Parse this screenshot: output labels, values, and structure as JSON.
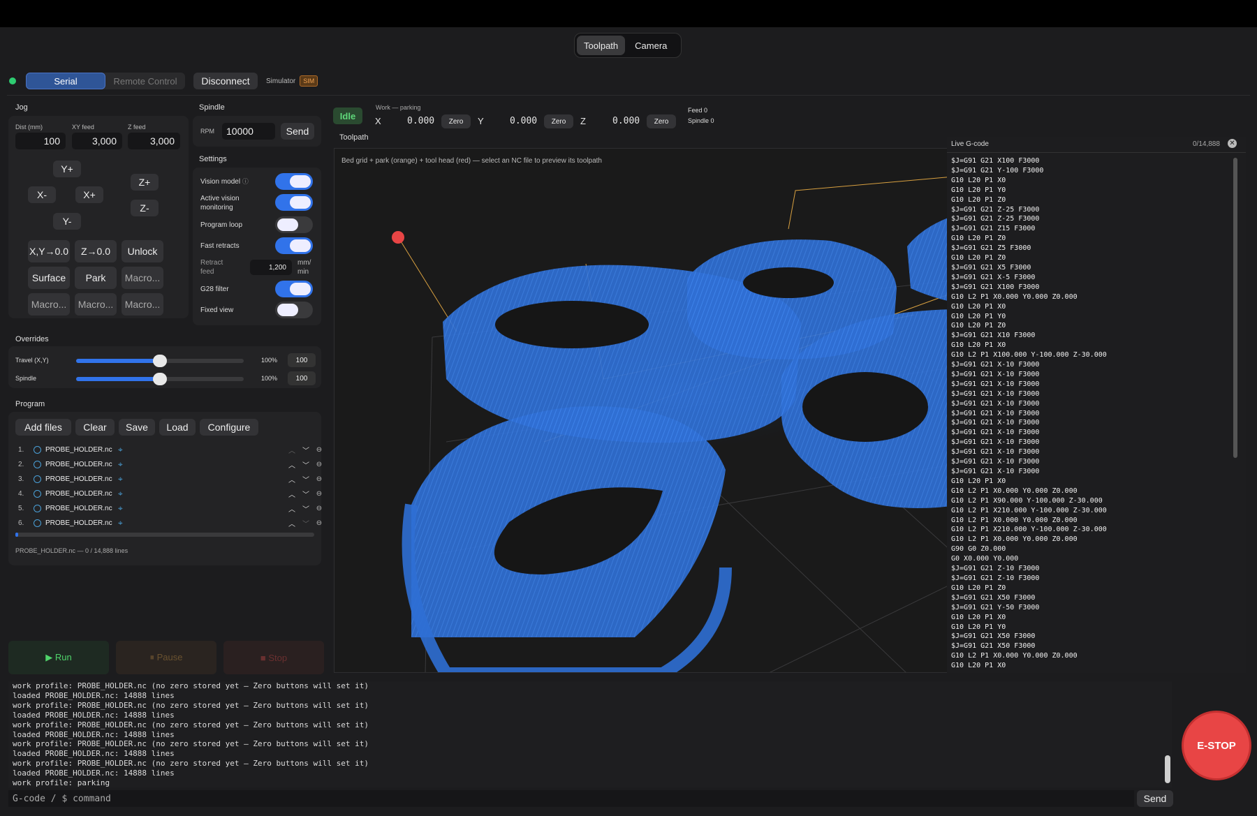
{
  "view_tabs": [
    "Toolpath",
    "Camera"
  ],
  "connection": {
    "modes": [
      "Serial",
      "Remote Control"
    ],
    "disconnect_label": "Disconnect",
    "simulator_label": "Simulator",
    "sim_badge": "SIM",
    "status_color": "#2ecc71"
  },
  "jog": {
    "title": "Jog",
    "dist_label": "Dist (mm)",
    "dist_value": "100",
    "xy_feed_label": "XY feed",
    "xy_feed_value": "3,000",
    "z_feed_label": "Z feed",
    "z_feed_value": "3,000",
    "y_plus": "Y+",
    "x_minus": "X-",
    "x_plus": "X+",
    "y_minus": "Y-",
    "z_plus": "Z+",
    "z_minus": "Z-",
    "buttons": [
      "X,Y→0.0",
      "Z→0.0",
      "Unlock",
      "Surface",
      "Park",
      "Macro...",
      "Macro...",
      "Macro...",
      "Macro..."
    ]
  },
  "spindle": {
    "title": "Spindle",
    "rpm_label": "RPM",
    "rpm_value": "10000",
    "send_label": "Send"
  },
  "settings": {
    "title": "Settings",
    "items": [
      {
        "label": "Vision model",
        "on": true,
        "info": true
      },
      {
        "label": "Active vision monitoring",
        "on": true
      },
      {
        "label": "Program loop",
        "on": false
      },
      {
        "label": "Fast retracts",
        "on": true
      },
      {
        "label": "G28 filter",
        "on": true
      },
      {
        "label": "Fixed view",
        "on": false
      }
    ],
    "retract_feed_label": "Retract feed",
    "retract_feed_value": "1,200",
    "retract_feed_unit": "mm/ min"
  },
  "overrides": {
    "title": "Overrides",
    "rows": [
      {
        "label": "Travel (X,Y)",
        "percent_text": "100%",
        "value": "100",
        "fraction": 0.5
      },
      {
        "label": "Spindle",
        "percent_text": "100%",
        "value": "100",
        "fraction": 0.5
      }
    ]
  },
  "program": {
    "title": "Program",
    "buttons": [
      "Add files",
      "Clear",
      "Save",
      "Load",
      "Configure"
    ],
    "files": [
      {
        "index": "1.",
        "name": "PROBE_HOLDER.nc"
      },
      {
        "index": "2.",
        "name": "PROBE_HOLDER.nc"
      },
      {
        "index": "3.",
        "name": "PROBE_HOLDER.nc"
      },
      {
        "index": "4.",
        "name": "PROBE_HOLDER.nc"
      },
      {
        "index": "5.",
        "name": "PROBE_HOLDER.nc"
      },
      {
        "index": "6.",
        "name": "PROBE_HOLDER.nc"
      }
    ],
    "progress_fraction": 0.0,
    "status": "PROBE_HOLDER.nc — 0 / 14,888 lines"
  },
  "run_controls": {
    "run": "▶ Run",
    "pause": "⏸ Pause",
    "stop": "■ Stop"
  },
  "machine_status": {
    "state": "Idle",
    "work_label": "Work — parking",
    "axes": [
      {
        "name": "X",
        "value": "0.000",
        "zero_label": "Zero"
      },
      {
        "name": "Y",
        "value": "0.000",
        "zero_label": "Zero"
      },
      {
        "name": "Z",
        "value": "0.000",
        "zero_label": "Zero"
      }
    ],
    "feed": "Feed 0",
    "spindle": "Spindle 0"
  },
  "toolpath": {
    "title": "Toolpath",
    "hint": "Bed grid + park (orange) + tool head (red) — select an NC file to preview its toolpath"
  },
  "live_gcode": {
    "title": "Live G-code",
    "counter": "0/14,888",
    "lines": [
      "$J=G91 G21 X100 F3000",
      "$J=G91 G21 Y-100 F3000",
      "G10 L20 P1 X0",
      "G10 L20 P1 Y0",
      "G10 L20 P1 Z0",
      "$J=G91 G21 Z-25 F3000",
      "$J=G91 G21 Z-25 F3000",
      "$J=G91 G21 Z15 F3000",
      "G10 L20 P1 Z0",
      "$J=G91 G21 Z5 F3000",
      "G10 L20 P1 Z0",
      "$J=G91 G21 X5 F3000",
      "$J=G91 G21 X-5 F3000",
      "$J=G91 G21 X100 F3000",
      "G10 L2 P1 X0.000 Y0.000 Z0.000",
      "G10 L20 P1 X0",
      "G10 L20 P1 Y0",
      "G10 L20 P1 Z0",
      "$J=G91 G21 X10 F3000",
      "G10 L20 P1 X0",
      "G10 L2 P1 X100.000 Y-100.000 Z-30.000",
      "$J=G91 G21 X-10 F3000",
      "$J=G91 G21 X-10 F3000",
      "$J=G91 G21 X-10 F3000",
      "$J=G91 G21 X-10 F3000",
      "$J=G91 G21 X-10 F3000",
      "$J=G91 G21 X-10 F3000",
      "$J=G91 G21 X-10 F3000",
      "$J=G91 G21 X-10 F3000",
      "$J=G91 G21 X-10 F3000",
      "$J=G91 G21 X-10 F3000",
      "$J=G91 G21 X-10 F3000",
      "$J=G91 G21 X-10 F3000",
      "G10 L20 P1 X0",
      "G10 L2 P1 X0.000 Y0.000 Z0.000",
      "G10 L2 P1 X90.000 Y-100.000 Z-30.000",
      "G10 L2 P1 X210.000 Y-100.000 Z-30.000",
      "G10 L2 P1 X0.000 Y0.000 Z0.000",
      "G10 L2 P1 X210.000 Y-100.000 Z-30.000",
      "G10 L2 P1 X0.000 Y0.000 Z0.000",
      "G90 G0 Z0.000",
      "G0 X0.000 Y0.000",
      "$J=G91 G21 Z-10 F3000",
      "$J=G91 G21 Z-10 F3000",
      "G10 L20 P1 Z0",
      "$J=G91 G21 X50 F3000",
      "$J=G91 G21 Y-50 F3000",
      "G10 L20 P1 X0",
      "G10 L20 P1 Y0",
      "$J=G91 G21 X50 F3000",
      "$J=G91 G21 X50 F3000",
      "G10 L2 P1 X0.000 Y0.000 Z0.000",
      "G10 L20 P1 X0"
    ]
  },
  "console": {
    "lines": [
      "work profile: PROBE_HOLDER.nc (no zero stored yet — Zero buttons will set it)",
      "loaded PROBE_HOLDER.nc: 14888 lines",
      "work profile: PROBE_HOLDER.nc (no zero stored yet — Zero buttons will set it)",
      "loaded PROBE_HOLDER.nc: 14888 lines",
      "work profile: PROBE_HOLDER.nc (no zero stored yet — Zero buttons will set it)",
      "loaded PROBE_HOLDER.nc: 14888 lines",
      "work profile: PROBE_HOLDER.nc (no zero stored yet — Zero buttons will set it)",
      "loaded PROBE_HOLDER.nc: 14888 lines",
      "work profile: PROBE_HOLDER.nc (no zero stored yet — Zero buttons will set it)",
      "loaded PROBE_HOLDER.nc: 14888 lines",
      "work profile: parking"
    ],
    "command_placeholder": "G-code / $ command",
    "send_label": "Send"
  },
  "estop_label": "E-STOP",
  "colors": {
    "accent": "#3173ea",
    "toolpath": "#2e6fd6",
    "tool_head": "#e84545",
    "park": "#d8a040",
    "idle": "#3ec06a"
  }
}
